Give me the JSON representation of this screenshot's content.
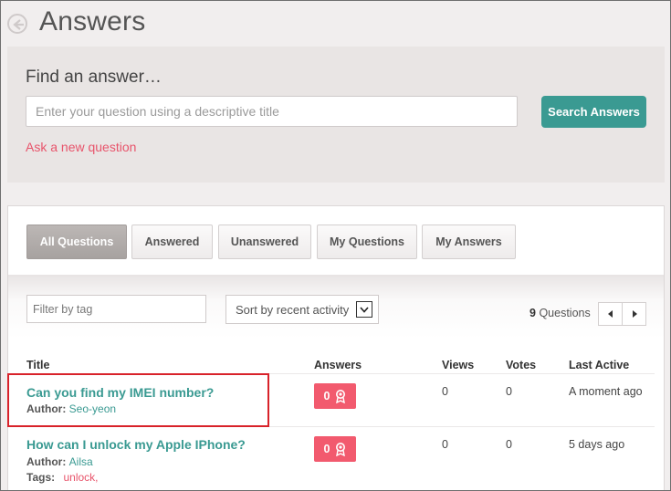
{
  "header": {
    "title": "Answers"
  },
  "search": {
    "label": "Find an answer…",
    "placeholder": "Enter your question using a descriptive title",
    "button": "Search Answers",
    "ask_link": "Ask a new question"
  },
  "tabs": [
    {
      "label": "All Questions",
      "active": true
    },
    {
      "label": "Answered",
      "active": false
    },
    {
      "label": "Unanswered",
      "active": false
    },
    {
      "label": "My Questions",
      "active": false
    },
    {
      "label": "My Answers",
      "active": false
    }
  ],
  "toolbar": {
    "tag_placeholder": "Filter by tag",
    "sort_value": "Sort by recent activity",
    "count": "9",
    "count_label": "Questions"
  },
  "table": {
    "columns": [
      "Title",
      "Answers",
      "Views",
      "Votes",
      "Last Active"
    ],
    "rows": [
      {
        "title": "Can you find my IMEI number?",
        "author_label": "Author:",
        "author": "Seo-yeon",
        "answers": "0",
        "views": "0",
        "votes": "0",
        "last_active": "A moment ago"
      },
      {
        "title": "How can I unlock my Apple IPhone?",
        "author_label": "Author:",
        "author": "Ailsa",
        "tags_label": "Tags:",
        "tags": "unlock,",
        "answers": "0",
        "views": "0",
        "votes": "0",
        "last_active": "5 days ago"
      }
    ]
  },
  "colors": {
    "accent": "#3a9a92",
    "link": "#e8546b",
    "badge": "#f25a6e",
    "highlight": "#d8222a"
  }
}
